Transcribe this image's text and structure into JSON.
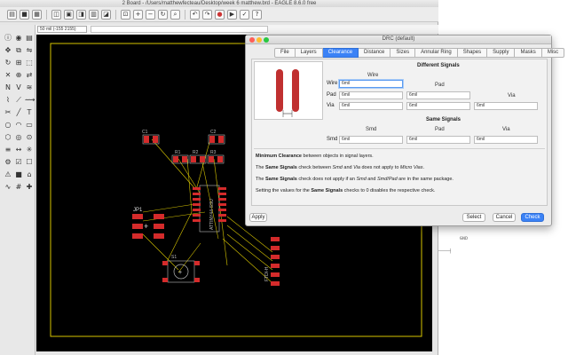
{
  "window": {
    "title": "2 Board - /Users/matthewfecteau/Desktop/week 6 matthew.brd - EAGLE 8.6.0 free"
  },
  "coordbar": {
    "coord": "50 mil (-155 2155)"
  },
  "icons": {
    "toolbar": [
      "open-icon",
      "save-icon",
      "print-icon",
      "cam-icon",
      "board-icon",
      "schematic-icon",
      "library-icon",
      "ulp-icon",
      "script-icon",
      "zoom-fit-icon",
      "zoom-in-icon",
      "zoom-out-icon",
      "zoom-redraw-icon",
      "zoom-select-icon",
      "undo-icon",
      "redo-icon",
      "stop-icon",
      "go-icon",
      "drc-icon",
      "erc-icon",
      "help-icon"
    ]
  },
  "board": {
    "labels": {
      "c1": "C1",
      "c2": "C2",
      "r1": "R1",
      "r2": "R2",
      "r3": "R3",
      "jp1": "JP1",
      "s1": "S1",
      "ic1": "ATTINY44-SSU",
      "header": "FTDI-H"
    }
  },
  "drc": {
    "title": "DRC (default)",
    "tabs": [
      "File",
      "Layers",
      "Clearance",
      "Distance",
      "Sizes",
      "Annular Ring",
      "Shapes",
      "Supply",
      "Masks",
      "Misc"
    ],
    "active_tab": "Clearance",
    "different_signals": {
      "title": "Different Signals",
      "col_wire": "Wire",
      "col_pad": "Pad",
      "col_via": "Via",
      "rows": [
        {
          "label": "Wire",
          "values": [
            "6mil"
          ]
        },
        {
          "label": "Pad",
          "values": [
            "6mil",
            "6mil"
          ]
        },
        {
          "label": "Via",
          "values": [
            "6mil",
            "6mil",
            "6mil"
          ]
        }
      ]
    },
    "same_signals": {
      "title": "Same Signals",
      "col_smd": "Smd",
      "col_pad": "Pad",
      "col_via": "Via",
      "row_label": "Smd",
      "values": [
        "6mil",
        "6mil",
        "6mil"
      ]
    },
    "notes": {
      "n1_bold": "Minimum Clearance",
      "n1_rest": " between objects in signal layers.",
      "n2_pre": "The ",
      "n2_bold": "Same Signals",
      "n2_mid": " check between ",
      "n2_i1": "Smd",
      "n2_and": " and ",
      "n2_i2": "Via",
      "n2_post": " does not apply to ",
      "n2_i3": "Micro Vias",
      "n2_end": ".",
      "n3_pre": "The ",
      "n3_bold": "Same Signals",
      "n3_mid": " check does not apply if an ",
      "n3_i1": "Smd",
      "n3_and": " and ",
      "n3_i2": "Smd/Pad",
      "n3_post": " are in the same package.",
      "n4_pre": "Setting the values for the ",
      "n4_bold": "Same Signals",
      "n4_post": " checks to 0 disables the respective check."
    },
    "buttons": {
      "apply": "Apply",
      "select": "Select",
      "cancel": "Cancel",
      "check": "Check"
    }
  },
  "background": {
    "text1": "GND",
    "text2": "────┤"
  },
  "colors": {
    "pad": "#d42b2b",
    "outline": "#d6c400",
    "accent": "#3b82f6"
  }
}
